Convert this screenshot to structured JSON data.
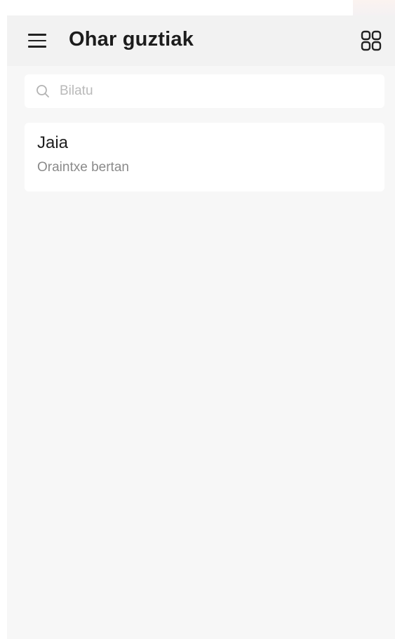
{
  "header": {
    "title": "Ohar guztiak",
    "menu_icon": "hamburger-menu-icon",
    "view_icon": "grid-view-icon"
  },
  "search": {
    "placeholder": "Bilatu",
    "value": "",
    "icon": "search-icon"
  },
  "notes": [
    {
      "title": "Jaia",
      "time": "Oraintxe bertan"
    }
  ],
  "colors": {
    "background": "#f7f7f7",
    "header": "#f2f2f2",
    "card": "#ffffff",
    "title_text": "#1c1c1c",
    "secondary_text": "#8a8a8a"
  }
}
